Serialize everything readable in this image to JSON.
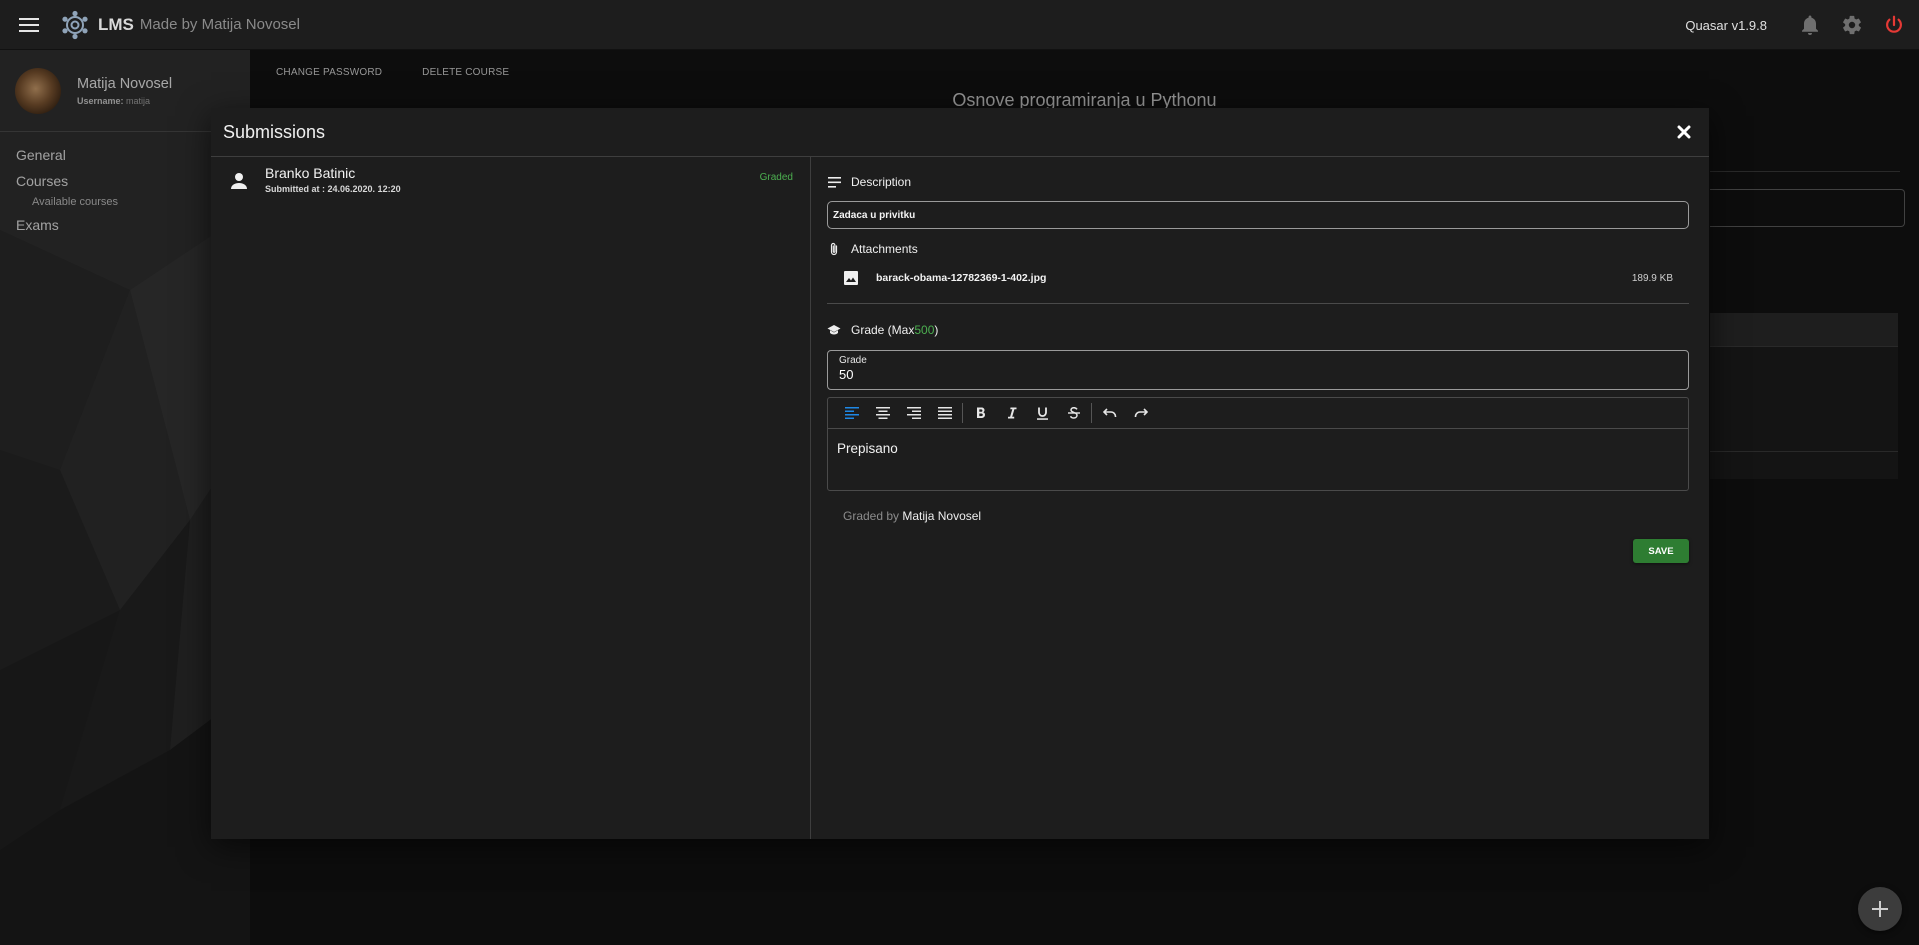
{
  "topbar": {
    "app_name": "LMS",
    "app_subtitle": "Made by Matija Novosel",
    "version": "Quasar v1.9.8",
    "icons": [
      "menu-icon",
      "atom-logo-icon",
      "bell-icon",
      "gear-icon",
      "power-icon"
    ]
  },
  "sidebar": {
    "user": {
      "name": "Matija Novosel",
      "username_label": "Username:",
      "username": "matija"
    },
    "items": [
      {
        "label": "General"
      },
      {
        "label": "Courses"
      },
      {
        "label": "Available courses"
      },
      {
        "label": "Exams"
      }
    ]
  },
  "main": {
    "tabs": [
      {
        "label": "Change Password"
      },
      {
        "label": "Delete Course"
      }
    ],
    "course_title": "Osnove programiranja u Pythonu"
  },
  "dialog": {
    "title": "Submissions",
    "submissions": [
      {
        "name": "Branko Batinic",
        "submitted_label": "Submitted at :",
        "submitted_at": "24.06.2020. 12:20",
        "status": "Graded"
      }
    ],
    "detail": {
      "description_label": "Description",
      "description": "Zadaca u privitku",
      "attachments_label": "Attachments",
      "attachments": [
        {
          "name": "barack-obama-12782369-1-402.jpg",
          "size": "189.9 KB"
        }
      ],
      "grade_label_prefix": "Grade (Max ",
      "grade_max": "500",
      "grade_label_suffix": ")",
      "grade_field_label": "Grade",
      "grade_value": "50",
      "editor_content": "Prepisano",
      "graded_by_label": "Graded by",
      "graded_by": "Matija Novosel",
      "save_label": "Save"
    }
  },
  "colors": {
    "accent_green": "#4caf50",
    "save_button": "#2e7d32",
    "power_icon": "#e53935",
    "active_tool": "#1e88e5"
  }
}
